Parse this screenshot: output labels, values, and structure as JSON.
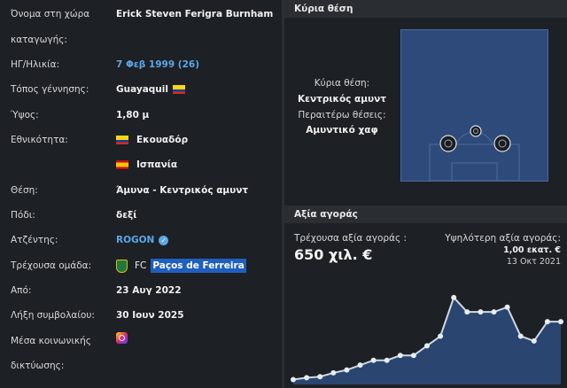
{
  "profile": {
    "rows": [
      {
        "label": "Όνομα στη χώρα",
        "value": "Erick Steven Ferigra Burnham"
      },
      {
        "label": "καταγωγής:",
        "value": ""
      },
      {
        "label": "ΗΓ/Ηλικία:",
        "value": "7 Φεβ 1999 (26)"
      },
      {
        "label": "Τόπος γέννησης:",
        "value": "Guayaquil"
      },
      {
        "label": "Ύψος:",
        "value": "1,80 μ"
      },
      {
        "label": "Εθνικότητα:",
        "value": "Εκουαδόρ"
      },
      {
        "label": "",
        "value": "Ισπανία"
      },
      {
        "label": "Θέση:",
        "value": "Άμυνα - Κεντρικός αμυντ"
      },
      {
        "label": "Πόδι:",
        "value": "δεξί"
      },
      {
        "label": "Ατζέντης:",
        "value": "ROGON"
      },
      {
        "label": "Τρέχουσα ομάδα:",
        "value_prefix": "FC",
        "value": "Paços de Ferreira"
      },
      {
        "label": "Από:",
        "value": "23 Αυγ 2022"
      },
      {
        "label": "Λήξη συμβολαίου:",
        "value": "30 Ιουν 2025"
      },
      {
        "label": "Μέσα κοινωνικής",
        "value": ""
      },
      {
        "label": "δικτύωσης:",
        "value": ""
      }
    ]
  },
  "position_panel": {
    "title": "Κύρια θέση",
    "main_label": "Κύρια θέση:",
    "main_value": "Κεντρικός αμυντ",
    "other_label": "Περαιτέρω θέσεις:",
    "other_value": "Αμυντικό χαφ",
    "pitch_color": "#2d4a7a"
  },
  "market_value": {
    "title": "Αξία αγοράς",
    "current_label": "Τρέχουσα αξία αγοράς :",
    "current_value": "650 χιλ. €",
    "highest_label": "Υψηλότερη αξία αγοράς:",
    "highest_value": "1,00 εκατ. €",
    "highest_date": "13 Οκτ 2021",
    "chart_data": {
      "type": "area",
      "values": [
        0.05,
        0.07,
        0.08,
        0.12,
        0.15,
        0.2,
        0.25,
        0.25,
        0.3,
        0.3,
        0.4,
        0.5,
        0.9,
        0.75,
        0.75,
        0.75,
        0.8,
        0.5,
        0.45,
        0.65,
        0.65
      ],
      "ylim": [
        0,
        1.1
      ],
      "fill_color": "#2a4670",
      "line_color": "#cfd8e3"
    }
  }
}
